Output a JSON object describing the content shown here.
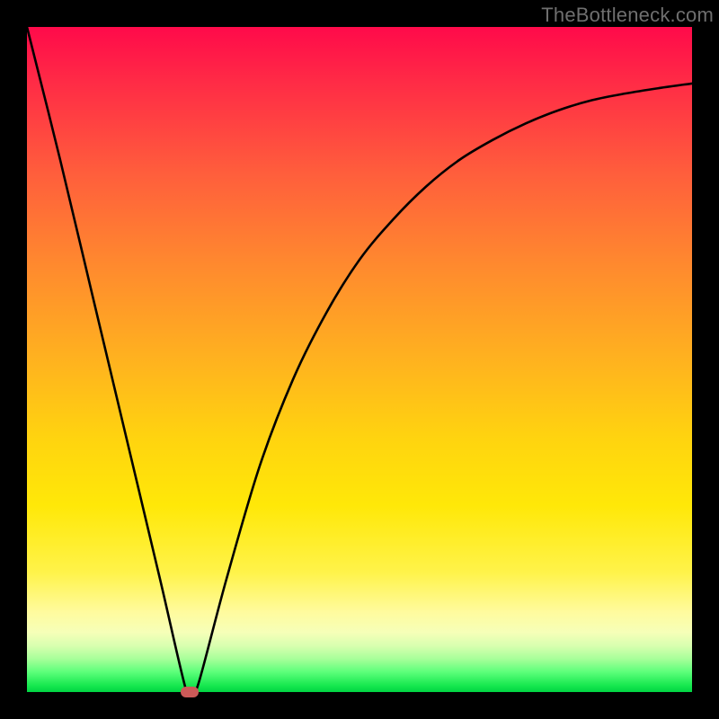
{
  "attribution": "TheBottleneck.com",
  "chart_data": {
    "type": "line",
    "title": "",
    "xlabel": "",
    "ylabel": "",
    "xlim": [
      0,
      100
    ],
    "ylim": [
      0,
      100
    ],
    "x": [
      0,
      5,
      10,
      15,
      20,
      24,
      25,
      26,
      30,
      35,
      40,
      45,
      50,
      55,
      60,
      65,
      70,
      75,
      80,
      85,
      90,
      95,
      100
    ],
    "y": [
      100,
      80,
      59,
      38,
      17,
      0,
      0,
      2,
      17,
      34,
      47,
      57,
      65,
      71,
      76,
      80,
      83,
      85.5,
      87.5,
      89,
      90,
      90.8,
      91.5
    ],
    "minimum_x": 24.5,
    "gradient_colors": {
      "top": "#ff0a4a",
      "mid": "#ffd40f",
      "bottom": "#00d443"
    },
    "marker": {
      "x": 24.5,
      "y": 0,
      "color": "#cb5a58"
    }
  }
}
